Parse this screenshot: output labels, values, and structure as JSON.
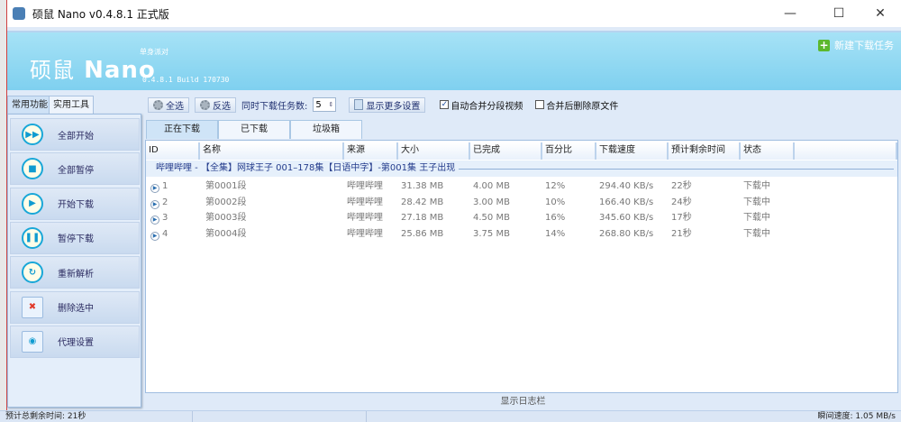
{
  "window": {
    "title": "硕鼠 Nano v0.4.8.1 正式版",
    "minimize": "—",
    "maximize": "☐",
    "close": "✕"
  },
  "banner": {
    "logo_cn": "硕鼠",
    "logo_en": "Nano",
    "slogan": "单身派对",
    "build": "0.4.8.1 Build 170730",
    "new_task": "新建下载任务"
  },
  "left_tabs": [
    "常用功能",
    "实用工具"
  ],
  "left_buttons": [
    {
      "label": "全部开始",
      "icon": "fast-forward-icon",
      "glyph": "▶▶"
    },
    {
      "label": "全部暂停",
      "icon": "stop-icon",
      "glyph": "■"
    },
    {
      "label": "开始下载",
      "icon": "play-icon",
      "glyph": "▶"
    },
    {
      "label": "暂停下载",
      "icon": "pause-icon",
      "glyph": "❚❚"
    },
    {
      "label": "重新解析",
      "icon": "refresh-icon",
      "glyph": "↻"
    },
    {
      "label": "删除选中",
      "icon": "delete-icon",
      "glyph": "✖"
    },
    {
      "label": "代理设置",
      "icon": "globe-icon",
      "glyph": "◉"
    }
  ],
  "toolbar": {
    "select_all": "全选",
    "invert": "反选",
    "concurrent_label": "同时下载任务数:",
    "concurrent_value": "5",
    "more_settings": "显示更多设置",
    "auto_merge": "自动合并分段视频",
    "auto_merge_checked": true,
    "delete_after_merge": "合并后删除原文件",
    "delete_after_merge_checked": false
  },
  "tabs": [
    "正在下载",
    "已下载",
    "垃圾箱"
  ],
  "table": {
    "columns": [
      "ID",
      "名称",
      "来源",
      "大小",
      "已完成",
      "百分比",
      "下载速度",
      "预计剩余时间",
      "状态"
    ],
    "group": "哔哩哔哩 - 【全集】网球王子 001–178集【日语中字】-第001集 王子出现",
    "rows": [
      [
        "1",
        "第0001段",
        "哔哩哔哩",
        "31.38 MB",
        "4.00 MB",
        "12%",
        "294.40 KB/s",
        "22秒",
        "下载中"
      ],
      [
        "2",
        "第0002段",
        "哔哩哔哩",
        "28.42 MB",
        "3.00 MB",
        "10%",
        "166.40 KB/s",
        "24秒",
        "下载中"
      ],
      [
        "3",
        "第0003段",
        "哔哩哔哩",
        "27.18 MB",
        "4.50 MB",
        "16%",
        "345.60 KB/s",
        "17秒",
        "下载中"
      ],
      [
        "4",
        "第0004段",
        "哔哩哔哩",
        "25.86 MB",
        "3.75 MB",
        "14%",
        "268.80 KB/s",
        "21秒",
        "下载中"
      ]
    ]
  },
  "log_bar": "显示日志栏",
  "status": {
    "remaining": "预计总剩余时间: 21秒",
    "speed": "瞬间速度: 1.05 MB/s"
  },
  "colors": {
    "banner": "#8fd8f2",
    "accent": "#19a7d8",
    "new_task_plus": "#5cb82d"
  }
}
